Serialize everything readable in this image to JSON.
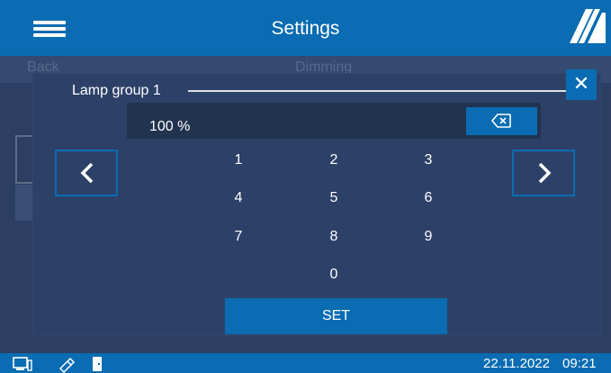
{
  "header": {
    "title": "Settings",
    "menu_icon": "hamburger-menu-icon",
    "logo_icon": "brand-stripes-logo"
  },
  "background": {
    "back_label": "Back",
    "tab_label": "Dimming"
  },
  "dialog": {
    "title": "Lamp group 1",
    "close_icon": "close-icon",
    "value": "100 %",
    "backspace_icon": "backspace-icon",
    "prev_icon": "chevron-left-icon",
    "next_icon": "chevron-right-icon",
    "keypad": [
      "1",
      "2",
      "3",
      "4",
      "5",
      "6",
      "7",
      "8",
      "9",
      "0"
    ],
    "set_label": "SET"
  },
  "statusbar": {
    "icons": [
      "monitor-icon",
      "usb-stick-icon",
      "door-icon"
    ],
    "date": "22.11.2022",
    "time": "09:21"
  },
  "colors": {
    "accent": "#0a6cb2",
    "panel": "#2d4168",
    "background": "#2c3f63"
  }
}
